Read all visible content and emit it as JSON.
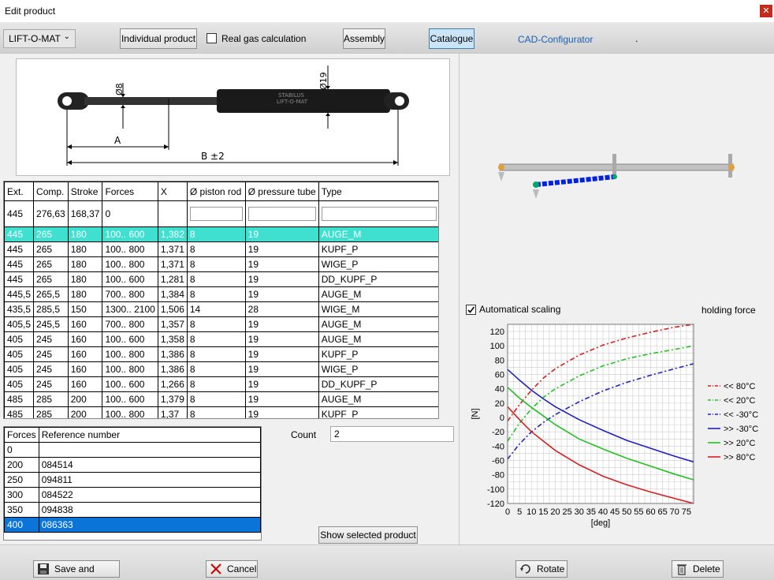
{
  "window": {
    "title": "Edit product",
    "close_icon": "close-icon"
  },
  "toolbar": {
    "type_select": "LIFT-O-MAT",
    "individual_product": "Individual product",
    "real_gas_label": "Real gas calculation",
    "assembly": "Assembly",
    "catalogue": "Catalogue",
    "cad_configurator": "CAD-Configurator",
    "dot": "."
  },
  "drawing": {
    "dim_rod": "Ø8",
    "dim_tube": "Ø19",
    "dim_a": "A",
    "dim_b": "B ±2",
    "brand_line1": "STABILUS",
    "brand_line2": "LIFT-O-MAT"
  },
  "products": {
    "columns": [
      "Ext.",
      "Comp.",
      "Stroke",
      "Forces",
      "X",
      "Ø piston rod",
      "Ø pressure tube",
      "Type"
    ],
    "filter_row": [
      "445",
      "276,63",
      "168,37",
      "0"
    ],
    "rows": [
      [
        "445",
        "265",
        "180",
        "100.. 600",
        "1,382",
        "8",
        "19",
        "AUGE_M"
      ],
      [
        "445",
        "265",
        "180",
        "100.. 800",
        "1,371",
        "8",
        "19",
        "KUPF_P"
      ],
      [
        "445",
        "265",
        "180",
        "100.. 800",
        "1,371",
        "8",
        "19",
        "WIGE_P"
      ],
      [
        "445",
        "265",
        "180",
        "100.. 600",
        "1,281",
        "8",
        "19",
        "DD_KUPF_P"
      ],
      [
        "445,5",
        "265,5",
        "180",
        "700.. 800",
        "1,384",
        "8",
        "19",
        "AUGE_M"
      ],
      [
        "435,5",
        "285,5",
        "150",
        "1300.. 2100",
        "1,506",
        "14",
        "28",
        "WIGE_M"
      ],
      [
        "405,5",
        "245,5",
        "160",
        "700.. 800",
        "1,357",
        "8",
        "19",
        "AUGE_M"
      ],
      [
        "405",
        "245",
        "160",
        "100.. 600",
        "1,358",
        "8",
        "19",
        "AUGE_M"
      ],
      [
        "405",
        "245",
        "160",
        "100.. 800",
        "1,386",
        "8",
        "19",
        "KUPF_P"
      ],
      [
        "405",
        "245",
        "160",
        "100.. 800",
        "1,386",
        "8",
        "19",
        "WIGE_P"
      ],
      [
        "405",
        "245",
        "160",
        "100.. 600",
        "1,266",
        "8",
        "19",
        "DD_KUPF_P"
      ],
      [
        "485",
        "285",
        "200",
        "100.. 600",
        "1,379",
        "8",
        "19",
        "AUGE_M"
      ],
      [
        "485",
        "285",
        "200",
        "100.. 800",
        "1,37",
        "8",
        "19",
        "KUPF_P"
      ]
    ],
    "selected_index": 0
  },
  "references": {
    "columns": [
      "Forces",
      "Reference number"
    ],
    "filter_row": [
      "0",
      ""
    ],
    "rows": [
      [
        "200",
        "084514"
      ],
      [
        "250",
        "094811"
      ],
      [
        "300",
        "084522"
      ],
      [
        "350",
        "094838"
      ],
      [
        "400",
        "086363"
      ]
    ],
    "selected_index": 4
  },
  "count": {
    "label": "Count",
    "value": "2"
  },
  "show_selected": "Show selected product",
  "scaling": {
    "label": "Automatical scaling",
    "checked": true
  },
  "chart_data": {
    "type": "line",
    "title": "holding force",
    "xlabel": "[deg]",
    "ylabel": "[N]",
    "xlim": [
      0,
      78
    ],
    "ylim": [
      -120,
      130
    ],
    "xticks": [
      0,
      5,
      10,
      15,
      20,
      25,
      30,
      35,
      40,
      45,
      50,
      55,
      60,
      65,
      70,
      75
    ],
    "yticks": [
      120,
      100,
      80,
      60,
      40,
      20,
      0,
      -20,
      -40,
      -60,
      -80,
      -100,
      -120
    ],
    "grid": true,
    "legend_position": "right",
    "series": [
      {
        "name": "<< 80°C",
        "color": "#d42020",
        "dash": true,
        "x": [
          0,
          5,
          10,
          15,
          20,
          30,
          40,
          50,
          60,
          70,
          78
        ],
        "y": [
          -5,
          18,
          38,
          55,
          68,
          87,
          101,
          111,
          119,
          126,
          130
        ]
      },
      {
        "name": "<< 20°C",
        "color": "#22c022",
        "dash": true,
        "x": [
          0,
          5,
          10,
          15,
          20,
          30,
          40,
          50,
          60,
          70,
          78
        ],
        "y": [
          -33,
          -8,
          12,
          28,
          40,
          58,
          72,
          82,
          89,
          95,
          100
        ]
      },
      {
        "name": "<< -30°C",
        "color": "#2020c0",
        "dash": true,
        "x": [
          0,
          5,
          10,
          15,
          20,
          30,
          40,
          50,
          60,
          70,
          78
        ],
        "y": [
          -58,
          -37,
          -20,
          -7,
          4,
          22,
          37,
          49,
          59,
          68,
          75
        ]
      },
      {
        "name": ">> -30°C",
        "color": "#2020c0",
        "dash": false,
        "x": [
          0,
          5,
          10,
          15,
          20,
          30,
          40,
          50,
          60,
          70,
          78
        ],
        "y": [
          67,
          52,
          38,
          26,
          15,
          -3,
          -18,
          -32,
          -43,
          -54,
          -62
        ]
      },
      {
        "name": ">> 20°C",
        "color": "#22c022",
        "dash": false,
        "x": [
          0,
          5,
          10,
          15,
          20,
          30,
          40,
          50,
          60,
          70,
          78
        ],
        "y": [
          42,
          27,
          14,
          2,
          -10,
          -30,
          -44,
          -57,
          -68,
          -79,
          -87
        ]
      },
      {
        "name": ">> 80°C",
        "color": "#d42020",
        "dash": false,
        "x": [
          0,
          5,
          10,
          15,
          20,
          30,
          40,
          50,
          60,
          70,
          78
        ],
        "y": [
          15,
          -3,
          -20,
          -33,
          -46,
          -66,
          -82,
          -94,
          -104,
          -113,
          -120
        ]
      }
    ]
  },
  "bottom": {
    "save_close": "Save and close",
    "cancel": "Cancel",
    "rotate": "Rotate",
    "delete": "Delete"
  }
}
